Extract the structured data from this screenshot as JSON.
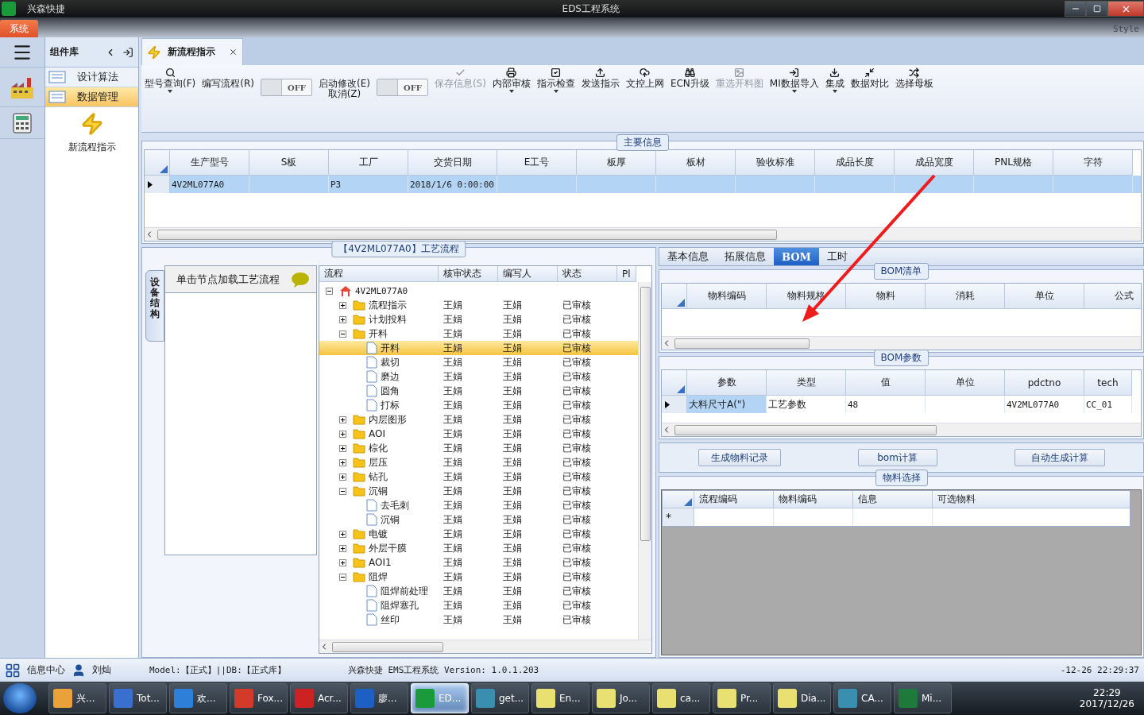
{
  "title_bar": {
    "app_name": "兴森快捷",
    "title": "EDS工程系统"
  },
  "ribbon_tabs": [
    {
      "label": "系统",
      "selected": true
    }
  ],
  "style_menu": "Style",
  "sidebar": {
    "title": "组件库",
    "items": [
      {
        "label": "设计算法",
        "selected": false
      },
      {
        "label": "数据管理",
        "selected": true
      }
    ],
    "tiles": [
      {
        "label": "新流程指示"
      }
    ]
  },
  "document_tab": {
    "label": "新流程指示",
    "selected": true
  },
  "toolbar": [
    {
      "kind": "button",
      "label": "型号查询(F)",
      "disabled": false,
      "dropdown": true
    },
    {
      "kind": "button",
      "label": "编写流程(R)",
      "disabled": false,
      "dropdown": false
    },
    {
      "kind": "toggle",
      "value": "OFF",
      "on": false
    },
    {
      "kind": "button",
      "label": "启动修改(E)\n取消(Z)",
      "disabled": false,
      "dropdown": false
    },
    {
      "kind": "toggle",
      "value": "OFF",
      "on": false
    },
    {
      "kind": "button",
      "label": "保存信息(S)",
      "disabled": true,
      "dropdown": false
    },
    {
      "kind": "button",
      "label": "内部审核",
      "disabled": false,
      "dropdown": true
    },
    {
      "kind": "button",
      "label": "指示检查",
      "disabled": false,
      "dropdown": true
    },
    {
      "kind": "button",
      "label": "发送指示",
      "disabled": false,
      "dropdown": false
    },
    {
      "kind": "button",
      "label": "文控上网",
      "disabled": false,
      "dropdown": false
    },
    {
      "kind": "button",
      "label": "ECN升级",
      "disabled": false,
      "dropdown": false
    },
    {
      "kind": "button",
      "label": "重选开料图",
      "disabled": true,
      "dropdown": false
    },
    {
      "kind": "button",
      "label": "MI数据导入",
      "disabled": false,
      "dropdown": true
    },
    {
      "kind": "button",
      "label": "集成",
      "disabled": false,
      "dropdown": true
    },
    {
      "kind": "button",
      "label": "数据对比",
      "disabled": false,
      "dropdown": false
    },
    {
      "kind": "button",
      "label": "选择母板",
      "disabled": false,
      "dropdown": false
    }
  ],
  "main_info": {
    "title": "主要信息",
    "columns": [
      "生产型号",
      "S板",
      "工厂",
      "交货日期",
      "E工号",
      "板厚",
      "板材",
      "验收标准",
      "成品长度",
      "成品宽度",
      "PNL规格",
      "字符"
    ],
    "rows": [
      {
        "selected": true,
        "cells": [
          "4V2ML077A0",
          "",
          "P3",
          "2018/1/6 0:00:00",
          "",
          "",
          "",
          "",
          "",
          "",
          "",
          ""
        ]
      }
    ]
  },
  "process": {
    "title": "【4V2ML077A0】工艺流程",
    "side_tab": "设备结构",
    "panel_header": "单击节点加载工艺流程",
    "columns": [
      "流程",
      "核审状态",
      "编写人",
      "状态",
      "Pl"
    ],
    "tree": [
      {
        "kind": "root",
        "label": "4V2ML077A0",
        "expanded": true,
        "selected": false,
        "children": [
          {
            "kind": "folder",
            "label": "流程指示",
            "reviewer": "王娟",
            "author": "王娟",
            "status": "已审核",
            "expanded": false,
            "selected": false
          },
          {
            "kind": "folder",
            "label": "计划投料",
            "reviewer": "王娟",
            "author": "王娟",
            "status": "已审核",
            "expanded": false,
            "selected": false
          },
          {
            "kind": "folder",
            "label": "开料",
            "reviewer": "王娟",
            "author": "王娟",
            "status": "已审核",
            "expanded": true,
            "selected": false,
            "children": [
              {
                "kind": "file",
                "label": "开料",
                "reviewer": "王娟",
                "author": "王娟",
                "status": "已审核",
                "selected": true
              },
              {
                "kind": "file",
                "label": "裁切",
                "reviewer": "王娟",
                "author": "王娟",
                "status": "已审核",
                "selected": false
              },
              {
                "kind": "file",
                "label": "磨边",
                "reviewer": "王娟",
                "author": "王娟",
                "status": "已审核",
                "selected": false
              },
              {
                "kind": "file",
                "label": "圆角",
                "reviewer": "王娟",
                "author": "王娟",
                "status": "已审核",
                "selected": false
              },
              {
                "kind": "file",
                "label": "打标",
                "reviewer": "王娟",
                "author": "王娟",
                "status": "已审核",
                "selected": false
              }
            ]
          },
          {
            "kind": "folder",
            "label": "内层图形",
            "reviewer": "王娟",
            "author": "王娟",
            "status": "已审核",
            "expanded": false,
            "selected": false
          },
          {
            "kind": "folder",
            "label": "AOI",
            "reviewer": "王娟",
            "author": "王娟",
            "status": "已审核",
            "expanded": false,
            "selected": false
          },
          {
            "kind": "folder",
            "label": "棕化",
            "reviewer": "王娟",
            "author": "王娟",
            "status": "已审核",
            "expanded": false,
            "selected": false
          },
          {
            "kind": "folder",
            "label": "层压",
            "reviewer": "王娟",
            "author": "王娟",
            "status": "已审核",
            "expanded": false,
            "selected": false
          },
          {
            "kind": "folder",
            "label": "钻孔",
            "reviewer": "王娟",
            "author": "王娟",
            "status": "已审核",
            "expanded": false,
            "selected": false
          },
          {
            "kind": "folder",
            "label": "沉铜",
            "reviewer": "王娟",
            "author": "王娟",
            "status": "已审核",
            "expanded": true,
            "selected": false,
            "children": [
              {
                "kind": "file",
                "label": "去毛刺",
                "reviewer": "王娟",
                "author": "王娟",
                "status": "已审核",
                "selected": false
              },
              {
                "kind": "file",
                "label": "沉铜",
                "reviewer": "王娟",
                "author": "王娟",
                "status": "已审核",
                "selected": false
              }
            ]
          },
          {
            "kind": "folder",
            "label": "电镀",
            "reviewer": "王娟",
            "author": "王娟",
            "status": "已审核",
            "expanded": false,
            "selected": false
          },
          {
            "kind": "folder",
            "label": "外层干膜",
            "reviewer": "王娟",
            "author": "王娟",
            "status": "已审核",
            "expanded": false,
            "selected": false
          },
          {
            "kind": "folder",
            "label": "AOI1",
            "reviewer": "王娟",
            "author": "王娟",
            "status": "已审核",
            "expanded": false,
            "selected": false
          },
          {
            "kind": "folder",
            "label": "阻焊",
            "reviewer": "王娟",
            "author": "王娟",
            "status": "已审核",
            "expanded": true,
            "selected": false,
            "children": [
              {
                "kind": "file",
                "label": "阻焊前处理",
                "reviewer": "王娟",
                "author": "王娟",
                "status": "已审核",
                "selected": false
              },
              {
                "kind": "file",
                "label": "阻焊塞孔",
                "reviewer": "王娟",
                "author": "王娟",
                "status": "已审核",
                "selected": false
              },
              {
                "kind": "file",
                "label": "丝印",
                "reviewer": "王娟",
                "author": "王娟",
                "status": "已审核",
                "selected": false
              }
            ]
          }
        ]
      }
    ]
  },
  "detail_tabs": [
    {
      "label": "基本信息",
      "selected": false
    },
    {
      "label": "拓展信息",
      "selected": false
    },
    {
      "label": "BOM",
      "selected": true
    },
    {
      "label": "工时",
      "selected": false
    }
  ],
  "bom_list": {
    "title": "BOM清单",
    "columns": [
      "物料编码",
      "物料规格",
      "物料",
      "消耗",
      "单位",
      "公式"
    ]
  },
  "bom_params": {
    "title": "BOM参数",
    "columns": [
      "参数",
      "类型",
      "值",
      "单位",
      "pdctno",
      "tech"
    ],
    "rows": [
      {
        "selected": true,
        "cells": [
          "大料尺寸A(\")",
          "工艺参数",
          "48",
          "",
          "4V2ML077A0",
          "CC_01"
        ]
      }
    ]
  },
  "actions": [
    "生成物料记录",
    "bom计算",
    "自动生成计算"
  ],
  "material_select": {
    "title": "物料选择",
    "columns": [
      "流程编码",
      "物料编码",
      "信息",
      "可选物料"
    ],
    "new_row_marker": "*"
  },
  "status_bar": {
    "info_center": "信息中心",
    "user": "刘灿",
    "model": "Model:【正式】||DB:【正式库】",
    "version": "兴森快捷 EMS工程系统 Version: 1.0.1.203",
    "clock": "-12-26 22:29:37"
  },
  "taskbar": {
    "items": [
      {
        "label": "兴...",
        "selected": false
      },
      {
        "label": "Tot...",
        "selected": false
      },
      {
        "label": "欢...",
        "selected": false
      },
      {
        "label": "Fox...",
        "selected": false
      },
      {
        "label": "Acr...",
        "selected": false
      },
      {
        "label": "廖...",
        "selected": false
      },
      {
        "label": "ED...",
        "selected": true
      },
      {
        "label": "get...",
        "selected": false
      },
      {
        "label": "En...",
        "selected": false
      },
      {
        "label": "Jo...",
        "selected": false
      },
      {
        "label": "ca...",
        "selected": false
      },
      {
        "label": "Pr...",
        "selected": false
      },
      {
        "label": "Dia...",
        "selected": false
      },
      {
        "label": "CA...",
        "selected": false
      },
      {
        "label": "Mi...",
        "selected": false
      }
    ],
    "time": "22:29",
    "date": "2017/12/26"
  },
  "annotation": {
    "kind": "arrow",
    "color": "#ee1c1c"
  }
}
